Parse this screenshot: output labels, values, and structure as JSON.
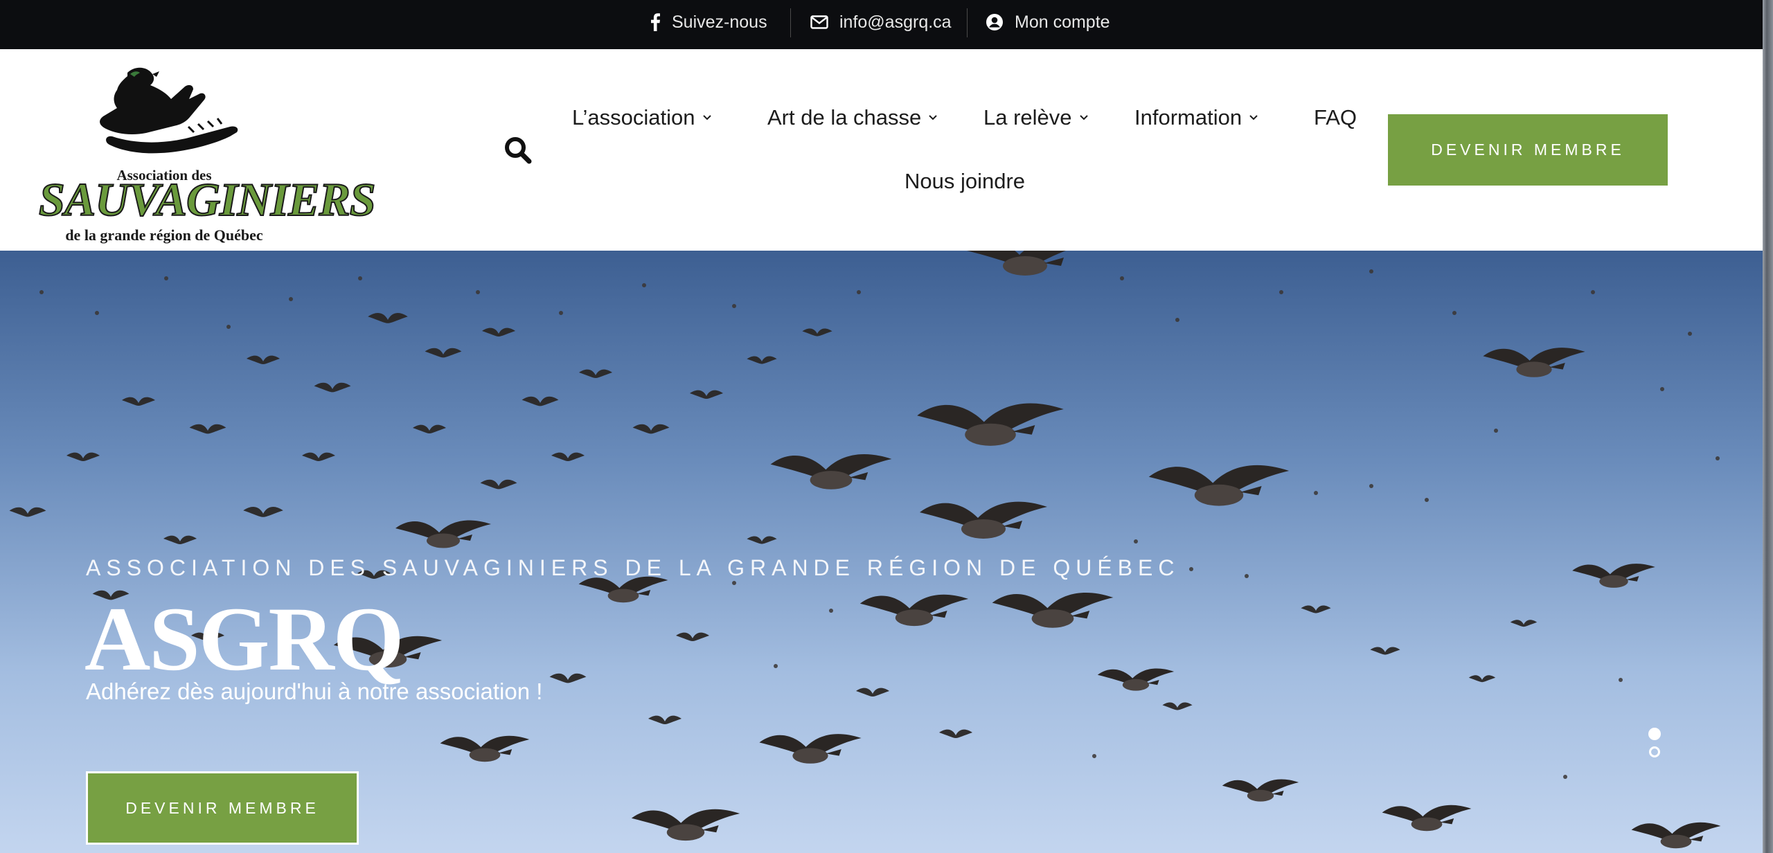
{
  "topbar": {
    "items": [
      {
        "icon": "facebook-icon",
        "label": "Suivez-nous"
      },
      {
        "icon": "envelope-icon",
        "label": "info@asgrq.ca"
      },
      {
        "icon": "user-circle-icon",
        "label": "Mon compte"
      }
    ]
  },
  "logo": {
    "line1": "Association des",
    "line2": "SAUVAGINIERS",
    "line3": "de la grande région de Québec"
  },
  "nav": {
    "items": [
      {
        "label": "L’association",
        "has_dropdown": true
      },
      {
        "label": "Art de la chasse",
        "has_dropdown": true
      },
      {
        "label": "La relève",
        "has_dropdown": true
      },
      {
        "label": "Information",
        "has_dropdown": true
      },
      {
        "label": "FAQ",
        "has_dropdown": false
      },
      {
        "label": "Nous joindre",
        "has_dropdown": false
      }
    ],
    "cta_label": "DEVENIR MEMBRE"
  },
  "hero": {
    "kicker": "ASSOCIATION DES SAUVAGINIERS DE LA GRANDE RÉGION DE QUÉBEC",
    "title": "ASGRQ",
    "subtitle": "Adhérez dès aujourd'hui à notre association !",
    "cta_label": "DEVENIR MEMBRE",
    "slides_total": 2,
    "active_slide": 1
  },
  "colors": {
    "accent_green": "#77a043",
    "topbar_bg": "#0c0d10",
    "logo_green": "#6a9a3c"
  }
}
